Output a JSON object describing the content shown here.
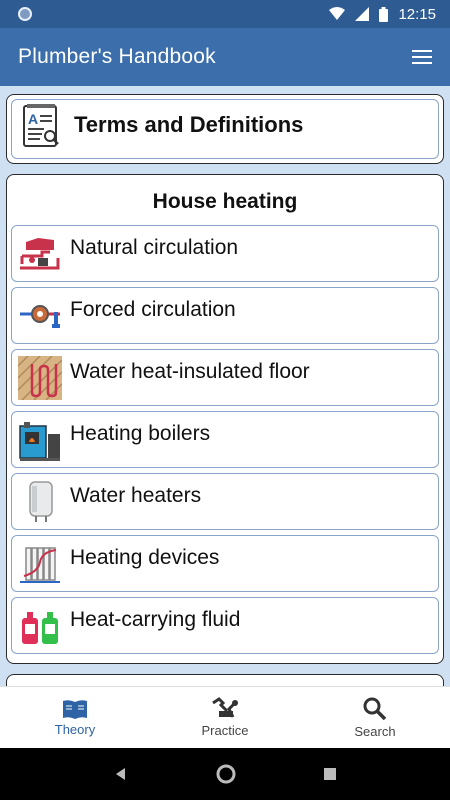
{
  "status_bar": {
    "time": "12:15"
  },
  "app_bar": {
    "title": "Plumber's Handbook"
  },
  "terms_card": {
    "title": "Terms and Definitions"
  },
  "section": {
    "title": "House heating",
    "items": [
      {
        "label": "Natural circulation",
        "icon": "natural-circulation-icon"
      },
      {
        "label": "Forced circulation",
        "icon": "pump-icon"
      },
      {
        "label": "Water heat-insulated floor",
        "icon": "floor-heating-icon"
      },
      {
        "label": "Heating boilers",
        "icon": "boiler-icon"
      },
      {
        "label": "Water heaters",
        "icon": "water-heater-icon"
      },
      {
        "label": "Heating devices",
        "icon": "radiator-icon"
      },
      {
        "label": "Heat-carrying fluid",
        "icon": "fluid-bottles-icon"
      }
    ]
  },
  "bottom_nav": {
    "items": [
      {
        "label": "Theory",
        "icon": "book-icon",
        "active": true
      },
      {
        "label": "Practice",
        "icon": "tools-icon",
        "active": false
      },
      {
        "label": "Search",
        "icon": "search-icon",
        "active": false
      }
    ]
  },
  "colors": {
    "app_bar": "#3b6eaa",
    "status_bar": "#2e5c92",
    "background": "#cfe0f2",
    "active_nav": "#2e64a6"
  }
}
